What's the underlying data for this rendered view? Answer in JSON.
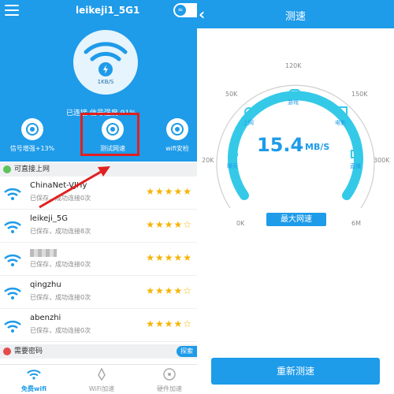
{
  "left": {
    "ssid_title": "leikeji1_5G1",
    "speed_label": "1KB/S",
    "status_text": "已连接 信号强度 91%",
    "tools": [
      {
        "label": "信号增强+13%"
      },
      {
        "label": "测试网速"
      },
      {
        "label": "wifi安检"
      }
    ],
    "section_open": "可直接上网",
    "networks": [
      {
        "name": "ChinaNet-VJHy",
        "status": "已保存，成功连接0次",
        "stars": "★★★★★"
      },
      {
        "name": "leikeji_5G",
        "status": "已保存，成功连接8次",
        "stars": "★★★★☆"
      },
      {
        "name": "",
        "status": "已保存，成功连接0次",
        "stars": "★★★★★"
      },
      {
        "name": "qingzhu",
        "status": "已保存，成功连接0次",
        "stars": "★★★★☆"
      },
      {
        "name": "abenzhi",
        "status": "已保存，成功连接0次",
        "stars": "★★★★☆"
      }
    ],
    "section_password": "需要密码",
    "explore_label": "探索",
    "nav": [
      {
        "label": "免费wifi"
      },
      {
        "label": "WiFi加速"
      },
      {
        "label": "硬件加速"
      }
    ]
  },
  "right": {
    "title": "测速",
    "speed_value": "15.4",
    "speed_unit": "MB/S",
    "ticks": [
      "0K",
      "20K",
      "50K",
      "120K",
      "150K",
      "300K",
      "6M"
    ],
    "categories": [
      "上网",
      "游戏",
      "电影",
      "聊天",
      "直播"
    ],
    "max_label": "最大网速",
    "retest_label": "重新测速"
  },
  "colors": {
    "primary": "#1e9be9",
    "gauge": "#35c9e8",
    "highlight": "#e02020",
    "star": "#f5b400"
  }
}
